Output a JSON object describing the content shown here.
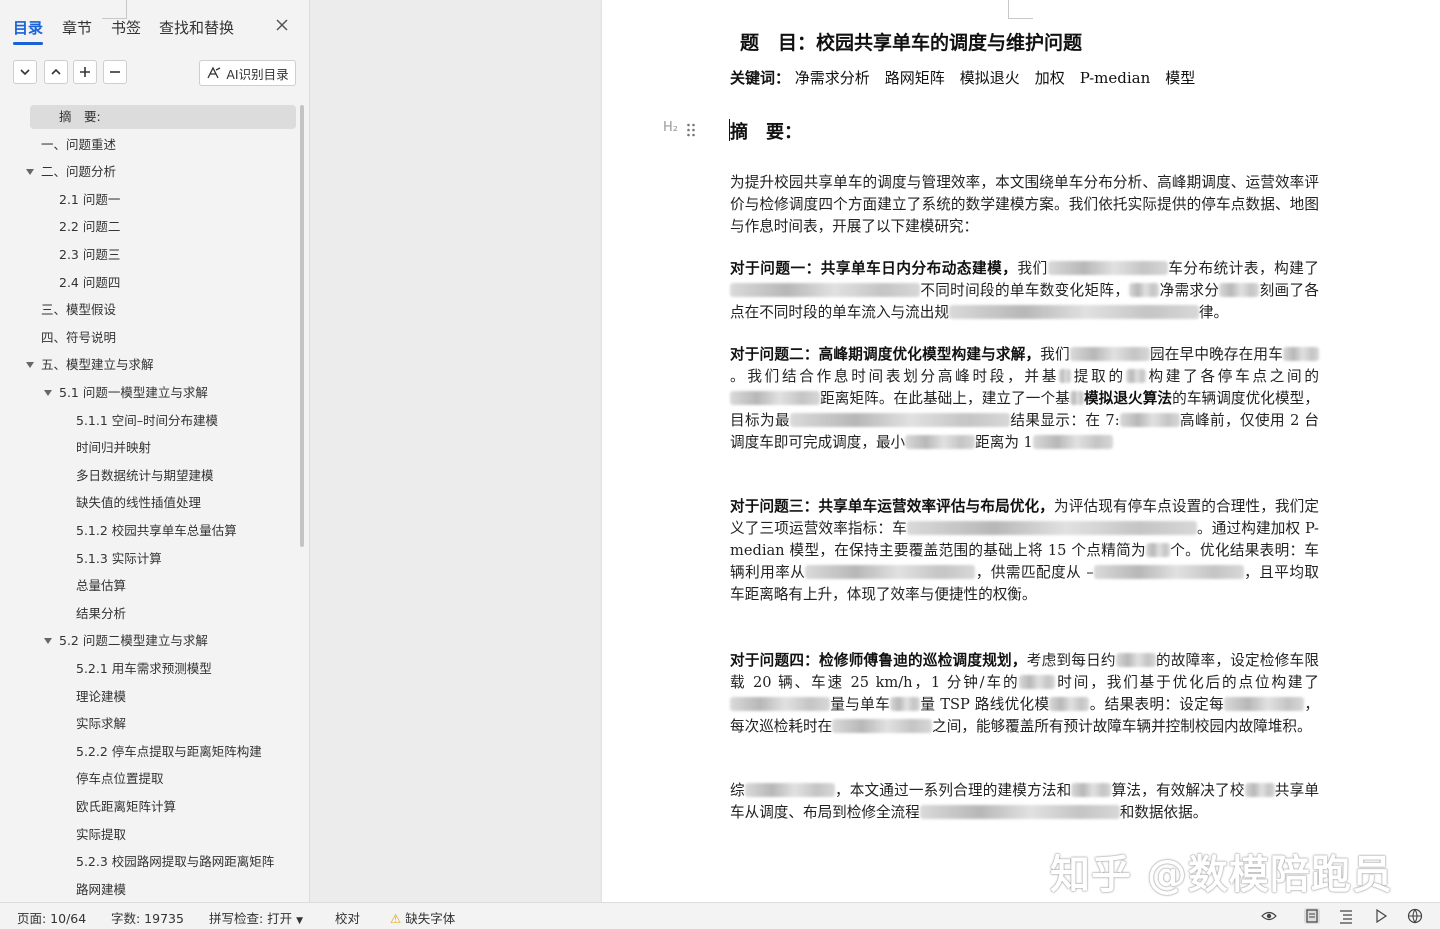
{
  "nav": {
    "tabs": [
      {
        "label": "目录",
        "active": true
      },
      {
        "label": "章节",
        "active": false
      },
      {
        "label": "书签",
        "active": false
      },
      {
        "label": "查找和替换",
        "active": false
      }
    ],
    "ai_button_label": "AI识别目录",
    "toc": [
      {
        "label": "摘　要:",
        "selected": true
      },
      {
        "label": "一、问题重述"
      },
      {
        "label": "二、问题分析",
        "expanded": true
      },
      {
        "label": "2.1 问题一"
      },
      {
        "label": "2.2 问题二"
      },
      {
        "label": "2.3 问题三"
      },
      {
        "label": "2.4 问题四"
      },
      {
        "label": "三、模型假设"
      },
      {
        "label": "四、符号说明"
      },
      {
        "label": "五、模型建立与求解",
        "expanded": true
      },
      {
        "label": "5.1 问题一模型建立与求解",
        "expanded": true
      },
      {
        "label": "5.1.1 空间–时间分布建模"
      },
      {
        "label": "时间归并映射"
      },
      {
        "label": "多日数据统计与期望建模"
      },
      {
        "label": "缺失值的线性插值处理"
      },
      {
        "label": "5.1.2 校园共享单车总量估算"
      },
      {
        "label": "5.1.3 实际计算"
      },
      {
        "label": "总量估算"
      },
      {
        "label": "结果分析"
      },
      {
        "label": "5.2 问题二模型建立与求解",
        "expanded": true
      },
      {
        "label": "5.2.1 用车需求预测模型"
      },
      {
        "label": "理论建模"
      },
      {
        "label": "实际求解"
      },
      {
        "label": "5.2.2 停车点提取与距离矩阵构建"
      },
      {
        "label": "停车点位置提取"
      },
      {
        "label": "欧氏距离矩阵计算"
      },
      {
        "label": "实际提取"
      },
      {
        "label": "5.2.3 校园路网提取与路网距离矩阵"
      },
      {
        "label": "路网建模"
      }
    ]
  },
  "document": {
    "title": "题　目：校园共享单车的调度与维护问题",
    "keywords_label": "关键词：",
    "keywords": "净需求分析　路网矩阵　模拟退火　加权　P-median　模型",
    "heading_marker": "H₂",
    "heading": "摘　要：",
    "intro": "为提升校园共享单车的调度与管理效率，本文围绕单车分布分析、高峰期调度、运营效率评价与检修调度四个方面建立了系统的数学建模方案。我们依托实际提供的停车点数据、地图与作息时间表，开展了以下建模研究：",
    "q1": {
      "bold": "对于问题一：共享单车日内分布动态建模，",
      "segments": [
        "我们",
        "车分布统计表，构建了",
        "不同时间段的单车数变化矩阵，",
        "净需求分",
        "刻画了各点在不同时段的单车流入与流出规",
        "律。"
      ]
    },
    "q2": {
      "bold": "对于问题二：高峰期调度优化模型构建与求解，",
      "segments": [
        "我们",
        "园在早中晚存在用车",
        "。我们结合作息时间表划分高峰时段，并基",
        "提取的",
        "构建了各停车点之间的",
        "距离矩阵。在此基础上，建立了一个基",
        "模拟退火算法",
        "的车辆调度优化模型，目标为最",
        "结果显示：在 7:",
        "高峰前，仅使用 2 台调度车即可完成调度，最小",
        "距离为 1"
      ]
    },
    "q3": {
      "bold": "对于问题三：共享单车运营效率评估与布局优化，",
      "segments": [
        "为评估现有停车点设置的合理性，我们定义了三项运营效率指标：车",
        "。通过构建加权 P-median 模型，在保持主要覆盖范围的基础上将 15 个点精简为",
        "个。优化结果表明：车辆利用率从",
        "，供需匹配度从 –",
        "，且平均取车距离略有上升，体现了效率与便捷性的权衡。"
      ]
    },
    "q4": {
      "bold": "对于问题四：检修师傅鲁迪的巡检调度规划，",
      "segments": [
        "考虑到每日约",
        "的故障率，设定检修车限载 20 辆、车速 25 km/h，1 分钟/车的",
        "时间，我们基于优化后的点位构建了",
        "量与单车",
        "量 TSP 路线优化模",
        "。结果表明：设定每",
        "，每次巡检耗时在",
        "之间，能够覆盖所有预计故障车辆并控制校园内故障堆积。"
      ]
    },
    "conclusion": {
      "segments": [
        "综",
        "，本文通过一系列合理的建模方法和",
        "算法，有效解决了校",
        "共享单车从调度、布局到检修全流程",
        "和数据依据。"
      ]
    }
  },
  "watermark": "知乎 @数模陪跑员",
  "status": {
    "page": "页面: 10/64",
    "words": "字数: 19735",
    "spellcheck": "拼写检查: 打开",
    "proofread": "校对",
    "missing_font": "缺失字体"
  }
}
